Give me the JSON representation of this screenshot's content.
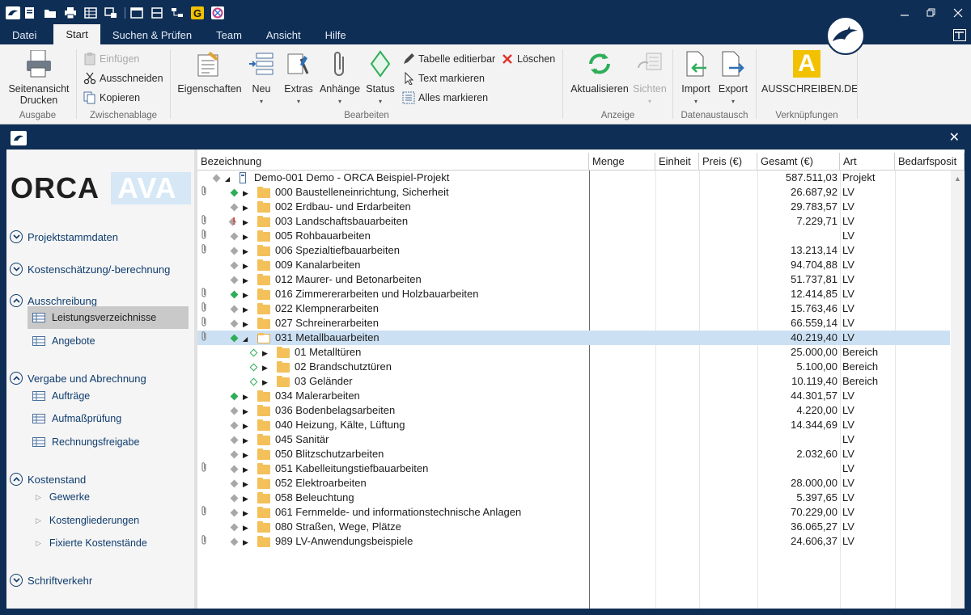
{
  "quick_access": {
    "icons": [
      "orca-icon",
      "new-icon",
      "open-icon",
      "print-icon",
      "table-icon",
      "grid-icon",
      "window-icon",
      "split-icon",
      "tree-icon",
      "g-icon",
      "target-icon"
    ],
    "g_label": "G"
  },
  "tabs": [
    "Datei",
    "Start",
    "Suchen & Prüfen",
    "Team",
    "Ansicht",
    "Hilfe"
  ],
  "ribbon": {
    "ausgabe": {
      "label": "Ausgabe",
      "print_l1": "Seitenansicht",
      "print_l2": "Drucken"
    },
    "zwischenablage": {
      "label": "Zwischenablage",
      "paste": "Einfügen",
      "cut": "Ausschneiden",
      "copy": "Kopieren"
    },
    "bearbeiten": {
      "label": "Bearbeiten",
      "props": "Eigenschaften",
      "new": "Neu",
      "extras": "Extras",
      "attach": "Anhänge",
      "status": "Status",
      "edit_table": "Tabelle editierbar",
      "delete": "Löschen",
      "mark_text": "Text markieren",
      "mark_all": "Alles markieren"
    },
    "anzeige": {
      "label": "Anzeige",
      "refresh": "Aktualisieren",
      "views": "Sichten"
    },
    "datenaustausch": {
      "label": "Datenaustausch",
      "import": "Import",
      "export": "Export"
    },
    "verknuepfungen": {
      "label": "Verknüpfungen",
      "ausschreiben": "AUSSCHREIBEN.DE",
      "a_letter": "A"
    }
  },
  "logo": {
    "part1": "ORCA",
    "part2": "AVA"
  },
  "nav": {
    "sections": [
      {
        "label": "Projektstammdaten",
        "open": false
      },
      {
        "label": "Kostenschätzung/-berechnung",
        "open": false
      },
      {
        "label": "Ausschreibung",
        "open": true
      },
      {
        "label": "Vergabe und Abrechnung",
        "open": true
      },
      {
        "label": "Kostenstand",
        "open": true
      },
      {
        "label": "Schriftverkehr",
        "open": false
      }
    ],
    "items": [
      "Leistungsverzeichnisse",
      "Angebote",
      "Aufträge",
      "Aufmaßprüfung",
      "Rechnungsfreigabe",
      "Gewerke",
      "Kostengliederungen",
      "Fixierte Kostenstände"
    ]
  },
  "grid": {
    "headers": [
      "Bezeichnung",
      "Menge",
      "Einheit",
      "Preis (€)",
      "Gesamt (€)",
      "Art",
      "Bedarfsposit"
    ],
    "rows": [
      {
        "name": "Demo-001 Demo - ORCA Beispiel-Projekt",
        "total": "587.511,03",
        "type": "Projekt",
        "level": 0,
        "clip": false,
        "status": "gray",
        "expanded": true,
        "icon": "project"
      },
      {
        "name": "000 Baustelleneinrichtung, Sicherheit",
        "total": "26.687,92",
        "type": "LV",
        "level": 1,
        "clip": true,
        "status": "green",
        "expanded": false,
        "icon": "folder"
      },
      {
        "name": "002 Erdbau- und Erdarbeiten",
        "total": "29.783,57",
        "type": "LV",
        "level": 1,
        "clip": false,
        "status": "gray",
        "expanded": false,
        "icon": "folder"
      },
      {
        "name": "003 Landschaftsbauarbeiten",
        "total": "7.229,71",
        "type": "LV",
        "level": 1,
        "clip": true,
        "status": "warn",
        "expanded": false,
        "icon": "folder"
      },
      {
        "name": "005 Rohbauarbeiten",
        "total": "",
        "type": "LV",
        "level": 1,
        "clip": true,
        "status": "gray",
        "expanded": false,
        "icon": "folder"
      },
      {
        "name": "006 Spezialtiefbauarbeiten",
        "total": "13.213,14",
        "type": "LV",
        "level": 1,
        "clip": true,
        "status": "gray",
        "expanded": false,
        "icon": "folder"
      },
      {
        "name": "009 Kanalarbeiten",
        "total": "94.704,88",
        "type": "LV",
        "level": 1,
        "clip": false,
        "status": "gray",
        "expanded": false,
        "icon": "folder"
      },
      {
        "name": "012 Maurer- und Betonarbeiten",
        "total": "51.737,81",
        "type": "LV",
        "level": 1,
        "clip": false,
        "status": "gray",
        "expanded": false,
        "icon": "folder"
      },
      {
        "name": "016 Zimmererarbeiten und Holzbauarbeiten",
        "total": "12.414,85",
        "type": "LV",
        "level": 1,
        "clip": true,
        "status": "green",
        "expanded": false,
        "icon": "folder"
      },
      {
        "name": "022 Klempnerarbeiten",
        "total": "15.763,46",
        "type": "LV",
        "level": 1,
        "clip": true,
        "status": "gray",
        "expanded": false,
        "icon": "folder"
      },
      {
        "name": "027 Schreinerarbeiten",
        "total": "66.559,14",
        "type": "LV",
        "level": 1,
        "clip": true,
        "status": "gray",
        "expanded": false,
        "icon": "folder"
      },
      {
        "name": "031 Metallbauarbeiten",
        "total": "40.219,40",
        "type": "LV",
        "level": 1,
        "clip": true,
        "status": "green",
        "expanded": true,
        "icon": "folder-open",
        "selected": true
      },
      {
        "name": "01 Metalltüren",
        "total": "25.000,00",
        "type": "Bereich",
        "level": 2,
        "clip": false,
        "status": "outline",
        "expanded": false,
        "icon": "folder"
      },
      {
        "name": "02 Brandschutztüren",
        "total": "5.100,00",
        "type": "Bereich",
        "level": 2,
        "clip": false,
        "status": "outline",
        "expanded": false,
        "icon": "folder"
      },
      {
        "name": "03 Geländer",
        "total": "10.119,40",
        "type": "Bereich",
        "level": 2,
        "clip": false,
        "status": "outline",
        "expanded": false,
        "icon": "folder"
      },
      {
        "name": "034 Malerarbeiten",
        "total": "44.301,57",
        "type": "LV",
        "level": 1,
        "clip": false,
        "status": "green",
        "expanded": false,
        "icon": "folder"
      },
      {
        "name": "036 Bodenbelagsarbeiten",
        "total": "4.220,00",
        "type": "LV",
        "level": 1,
        "clip": false,
        "status": "gray",
        "expanded": false,
        "icon": "folder"
      },
      {
        "name": "040 Heizung, Kälte, Lüftung",
        "total": "14.344,69",
        "type": "LV",
        "level": 1,
        "clip": false,
        "status": "gray",
        "expanded": false,
        "icon": "folder"
      },
      {
        "name": "045 Sanitär",
        "total": "",
        "type": "LV",
        "level": 1,
        "clip": false,
        "status": "gray",
        "expanded": false,
        "icon": "folder"
      },
      {
        "name": "050 Blitzschutzarbeiten",
        "total": "2.032,60",
        "type": "LV",
        "level": 1,
        "clip": false,
        "status": "gray",
        "expanded": false,
        "icon": "folder"
      },
      {
        "name": "051 Kabelleitungstiefbauarbeiten",
        "total": "",
        "type": "LV",
        "level": 1,
        "clip": true,
        "status": "gray",
        "expanded": false,
        "icon": "folder"
      },
      {
        "name": "052 Elektroarbeiten",
        "total": "28.000,00",
        "type": "LV",
        "level": 1,
        "clip": false,
        "status": "gray",
        "expanded": false,
        "icon": "folder"
      },
      {
        "name": "058 Beleuchtung",
        "total": "5.397,65",
        "type": "LV",
        "level": 1,
        "clip": false,
        "status": "gray",
        "expanded": false,
        "icon": "folder"
      },
      {
        "name": "061 Fernmelde- und informationstechnische Anlagen",
        "total": "70.229,00",
        "type": "LV",
        "level": 1,
        "clip": true,
        "status": "gray",
        "expanded": false,
        "icon": "folder"
      },
      {
        "name": "080 Straßen, Wege, Plätze",
        "total": "36.065,27",
        "type": "LV",
        "level": 1,
        "clip": false,
        "status": "gray",
        "expanded": false,
        "icon": "folder"
      },
      {
        "name": "989 LV-Anwendungsbeispiele",
        "total": "24.606,37",
        "type": "LV",
        "level": 1,
        "clip": true,
        "status": "gray",
        "expanded": false,
        "icon": "folder"
      }
    ]
  },
  "colors": {
    "navy": "#0f2e55",
    "green": "#2fae5a",
    "gray": "#a8a8a8",
    "warn": "#e0322a",
    "select": "#cce0f3",
    "folder": "#f3c05a"
  }
}
